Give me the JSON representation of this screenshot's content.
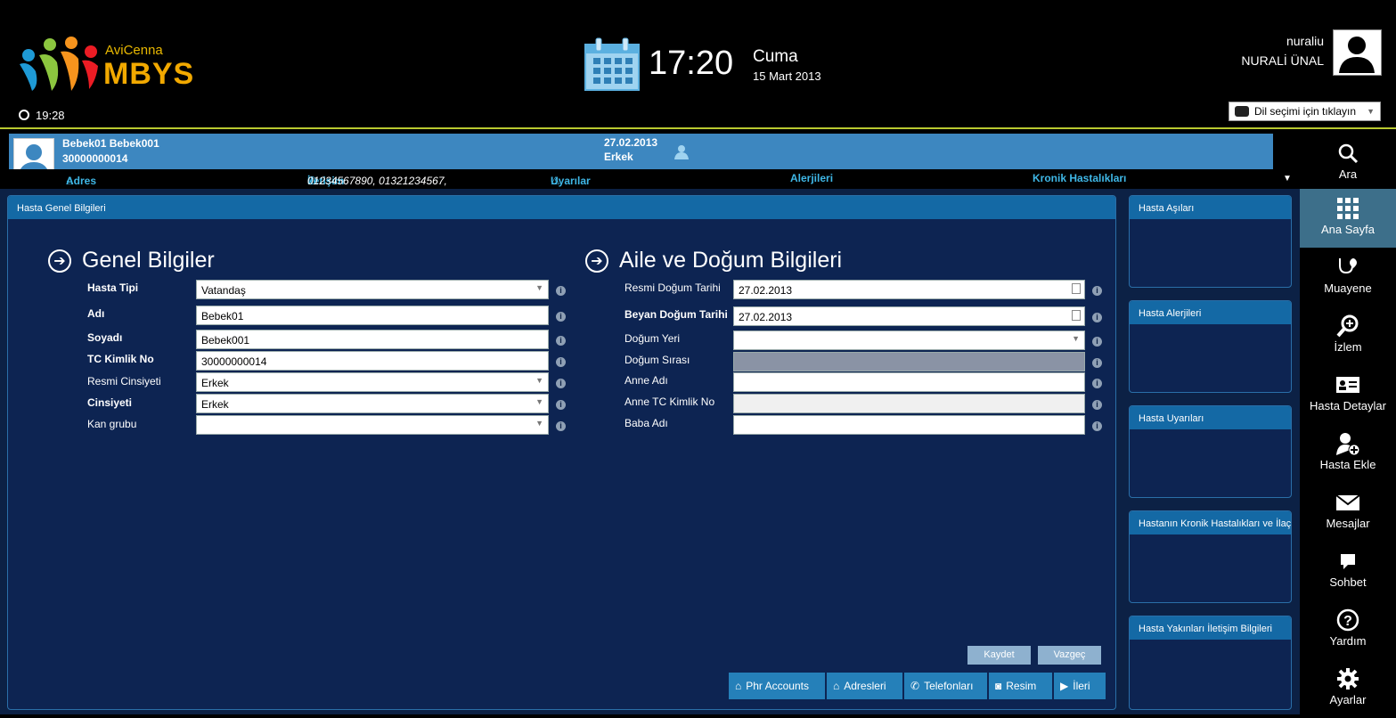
{
  "header": {
    "logo_small": "AviCenna",
    "logo_big": "MBYS",
    "small_clock": "19:28",
    "time": "17:20",
    "day": "Cuma",
    "date": "15 Mart 2013",
    "username": "nuraliu",
    "full_name": "NURALİ ÜNAL",
    "language_label": "Dil seçimi için tıklayın"
  },
  "patient": {
    "name": "Bebek01 Bebek001",
    "tc": "30000000014",
    "birth_date": "27.02.2013",
    "gender": "Erkek"
  },
  "info_strip": {
    "address": "Adres",
    "contact_label": "İletişim",
    "contact_value": "01234567890, 01321234567,",
    "warnings": "Uyarılar",
    "allergies": "Alerjileri",
    "chronic": "Kronik Hastalıkları"
  },
  "nav": [
    {
      "label": "Ara",
      "icon": "search-icon"
    },
    {
      "label": "Ana Sayfa",
      "icon": "grid-icon"
    },
    {
      "label": "Muayene",
      "icon": "stethoscope-icon"
    },
    {
      "label": "İzlem",
      "icon": "magnifier-plus-icon"
    },
    {
      "label": "Hasta Detaylar",
      "icon": "id-card-icon"
    },
    {
      "label": "Hasta Ekle",
      "icon": "user-add-icon"
    },
    {
      "label": "Mesajlar",
      "icon": "envelope-icon"
    },
    {
      "label": "Sohbet",
      "icon": "chat-icon"
    },
    {
      "label": "Yardım",
      "icon": "help-icon"
    },
    {
      "label": "Ayarlar",
      "icon": "gear-icon"
    }
  ],
  "main_panel": {
    "title": "Hasta Genel Bilgileri",
    "general_title": "Genel Bilgiler",
    "family_title": "Aile ve Doğum Bilgileri"
  },
  "general_fields": [
    {
      "label": "Hasta Tipi",
      "value": "Vatandaş",
      "type": "select"
    },
    {
      "label": "Adı",
      "value": "Bebek01",
      "type": "text"
    },
    {
      "label": "Soyadı",
      "value": "Bebek001",
      "type": "text"
    },
    {
      "label": "TC Kimlik No",
      "value": "30000000014",
      "type": "text"
    },
    {
      "label": "Resmi Cinsiyeti",
      "value": "Erkek",
      "type": "select"
    },
    {
      "label": "Cinsiyeti",
      "value": "Erkek",
      "type": "select"
    },
    {
      "label": "Kan grubu",
      "value": "",
      "type": "select"
    }
  ],
  "family_fields": [
    {
      "label": "Resmi Doğum Tarihi",
      "value": "27.02.2013",
      "type": "date"
    },
    {
      "label": "Beyan Doğum Tarihi",
      "value": "27.02.2013",
      "type": "date"
    },
    {
      "label": "Doğum Yeri",
      "value": "",
      "type": "select"
    },
    {
      "label": "Doğum Sırası",
      "value": "",
      "type": "disabled"
    },
    {
      "label": "Anne Adı",
      "value": "",
      "type": "text"
    },
    {
      "label": "Anne TC Kimlik No",
      "value": "",
      "type": "text"
    },
    {
      "label": "Baba Adı",
      "value": "",
      "type": "text"
    }
  ],
  "buttons": {
    "save": "Kaydet",
    "cancel": "Vazgeç",
    "phr": "Phr Accounts",
    "addresses": "Adresleri",
    "phones": "Telefonları",
    "photo": "Resim",
    "next": "İleri"
  },
  "side_panels": [
    "Hasta Aşıları",
    "Hasta Alerjileri",
    "Hasta Uyarıları",
    "Hastanın Kronik Hastalıkları ve İlaçları",
    "Hasta Yakınları İletişim Bilgileri"
  ],
  "colors": {
    "accent_line": "#b9c930",
    "patient_band": "#3d87c0",
    "main_bg": "#0c2145",
    "panel_head": "#1469a5",
    "logo_orange": "#f2a900"
  }
}
